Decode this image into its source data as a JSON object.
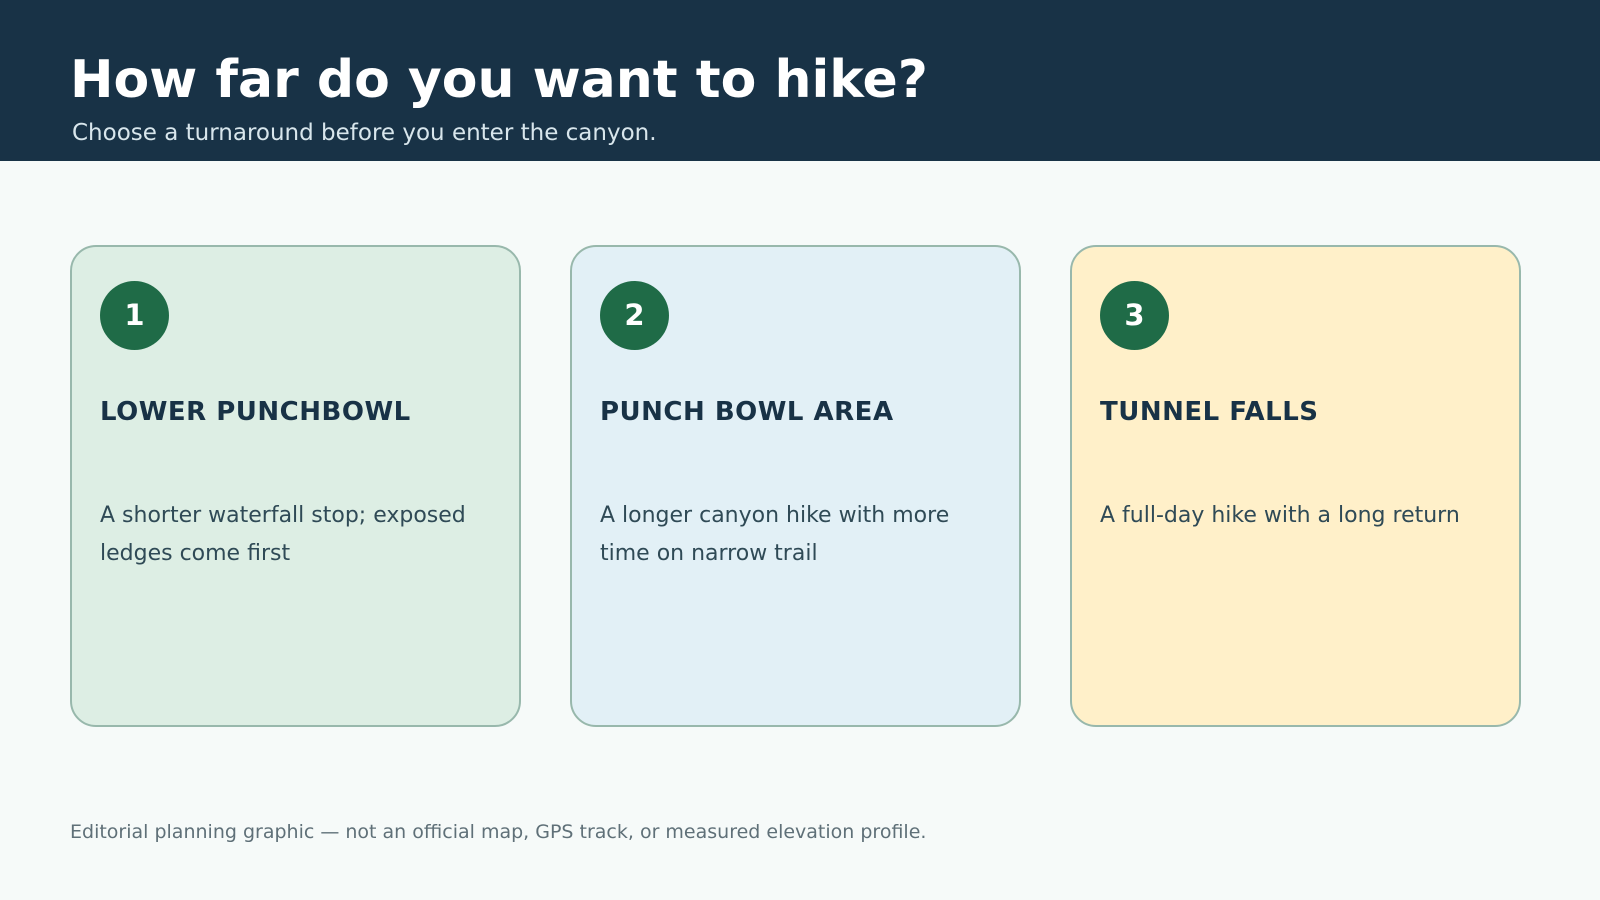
{
  "header": {
    "title": "How far do you want to hike?",
    "subtitle": "Choose a turnaround before you enter the canyon."
  },
  "cards": [
    {
      "number": "1",
      "title": "LOWER PUNCHBOWL",
      "description": "A shorter waterfall stop; exposed ledges come first",
      "background": "#ddeee4"
    },
    {
      "number": "2",
      "title": "PUNCH BOWL AREA",
      "description": "A longer canyon hike with more time on narrow trail",
      "background": "#e2f0f6"
    },
    {
      "number": "3",
      "title": "TUNNEL FALLS",
      "description": "A full-day hike with a long return",
      "background": "#fff0c9"
    }
  ],
  "footer": {
    "note": "Editorial planning graphic — not an official map, GPS track, or measured elevation profile."
  },
  "colors": {
    "header_background": "#183246",
    "page_background": "#f6faf9",
    "badge": "#1f6b47",
    "card_border": "#98b8ac"
  }
}
